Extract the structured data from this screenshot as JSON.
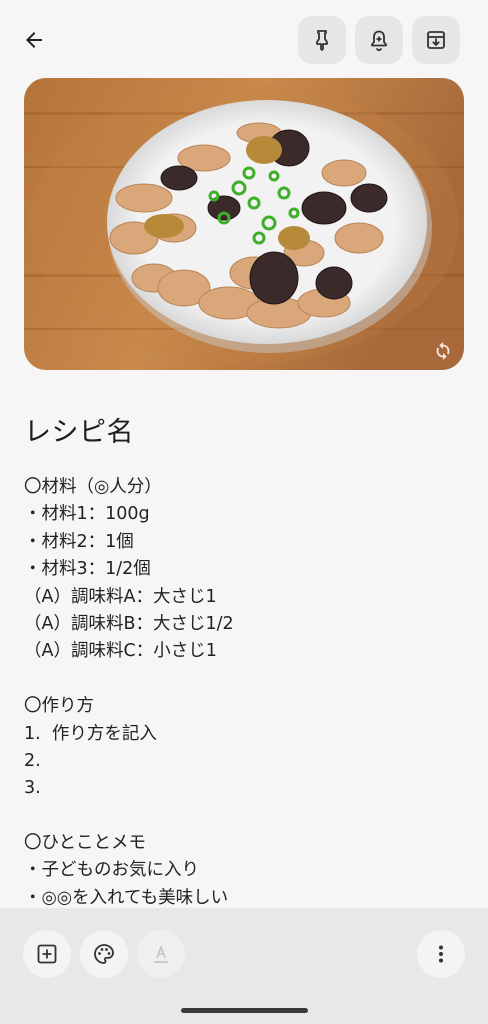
{
  "toolbar": {
    "back_icon": "arrow-left-icon",
    "pin_icon": "pin-icon",
    "reminder_icon": "bell-plus-icon",
    "archive_icon": "archive-icon"
  },
  "note": {
    "image": "braised eggplant and pork with green onions on white plate",
    "title": "レシピ名",
    "lines": [
      "〇材料（◎人分）",
      "・材料1：100g",
      "・材料2：1個",
      "・材料3：1/2個",
      "（A）調味料A：大さじ1",
      "（A）調味料B：大さじ1/2",
      "（A）調味料C：小さじ1",
      "",
      "〇作り方",
      "1.  作り方を記入",
      "2.",
      "3.",
      "",
      "〇ひとことメモ",
      "・子どものお気に入り",
      "・◎◎を入れても美味しい"
    ]
  },
  "bottom_toolbar": {
    "add_icon": "add-box-icon",
    "palette_icon": "palette-icon",
    "text_format_icon": "text-format-icon",
    "more_icon": "more-vertical-icon"
  },
  "colors": {
    "background": "#f6f6f6",
    "toolbar_button": "#e6e6e6",
    "bottom_bar": "#e8e8e8"
  }
}
